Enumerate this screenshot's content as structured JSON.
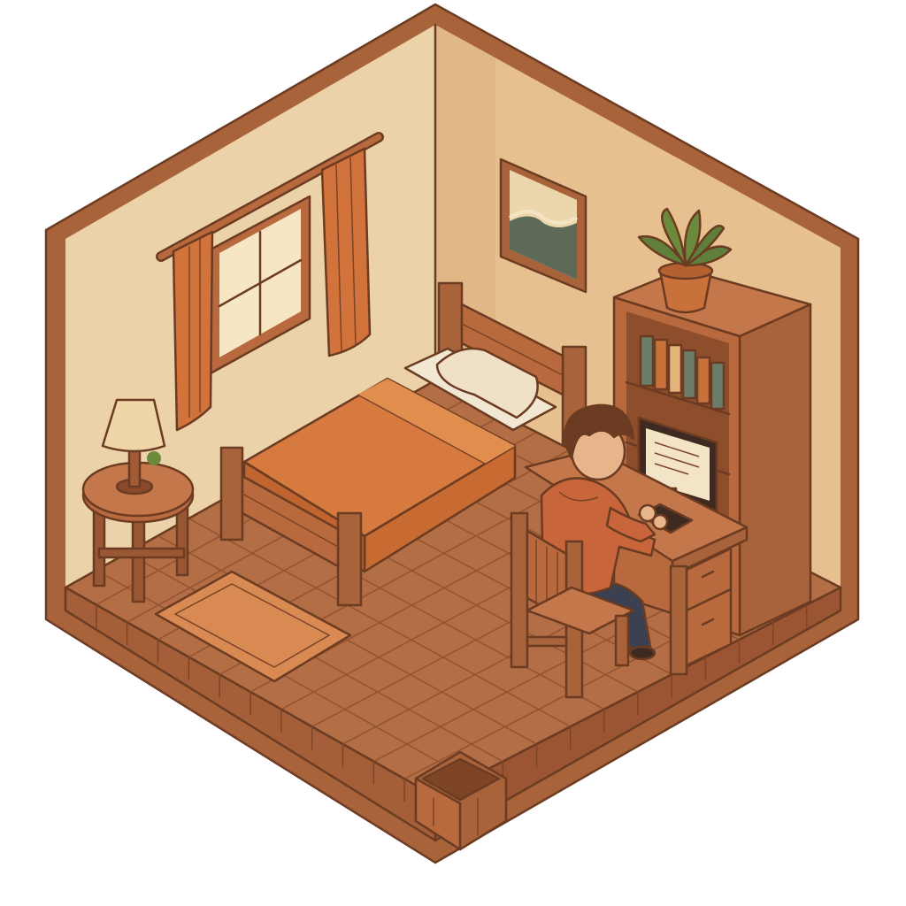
{
  "scene": {
    "kind": "isometric-room",
    "palette": {
      "outline": "#6b3b22",
      "wall_left": "#ecd2a8",
      "wall_right": "#e6c08e",
      "frame": "#a8633a",
      "floor": "#b36e45",
      "floor_tile_line": "#8e4e2c",
      "bedsheet": "#d77a3f",
      "curtain": "#d2733c",
      "window_glass": "#f6e6c3",
      "plant": "#5f7f3a",
      "screen": "#f4e4c6"
    },
    "objects": [
      {
        "name": "window-with-curtains"
      },
      {
        "name": "wall-picture"
      },
      {
        "name": "bed"
      },
      {
        "name": "nightstand-with-lamp"
      },
      {
        "name": "rug"
      },
      {
        "name": "bookshelf-with-books"
      },
      {
        "name": "potted-plant"
      },
      {
        "name": "desk-with-computer"
      },
      {
        "name": "chair"
      },
      {
        "name": "person-typing"
      },
      {
        "name": "waste-basket"
      }
    ]
  }
}
